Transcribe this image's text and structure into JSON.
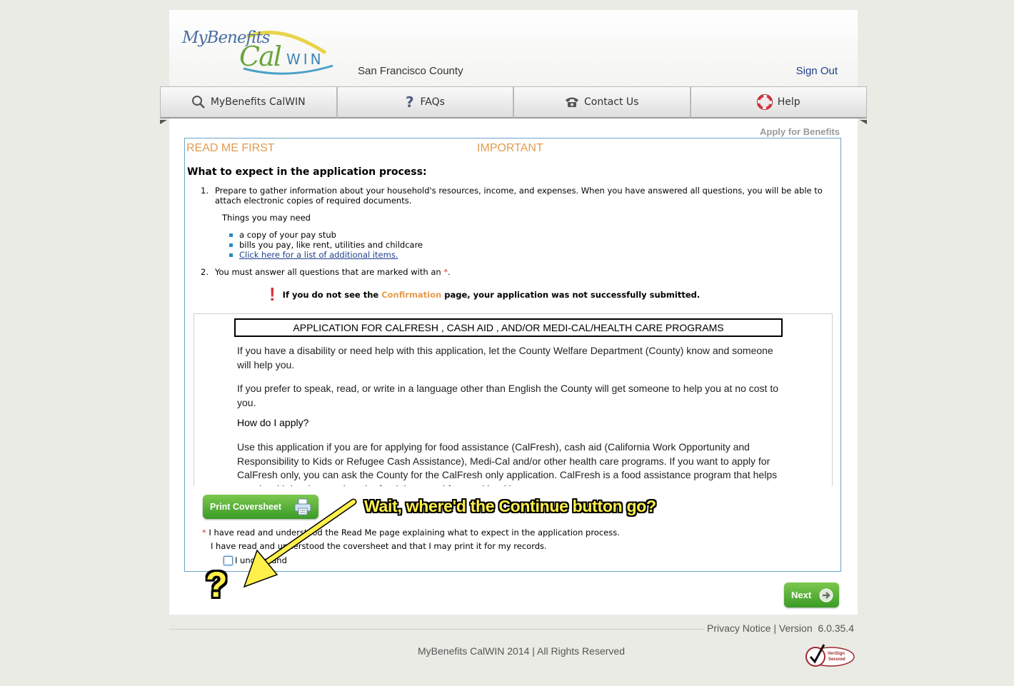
{
  "header": {
    "logo_text": "MyBenefits CalWIN",
    "county": "San Francisco County",
    "sign_out": "Sign Out"
  },
  "nav": {
    "items": [
      {
        "label": "MyBenefits CalWIN",
        "icon": "search-icon"
      },
      {
        "label": "FAQs",
        "icon": "question-icon"
      },
      {
        "label": "Contact Us",
        "icon": "telephone-icon"
      },
      {
        "label": "Help",
        "icon": "lifebuoy-icon"
      }
    ]
  },
  "breadcrumb": "Apply for Benefits",
  "panel": {
    "read_me_first": "READ ME FIRST",
    "important": "IMPORTANT",
    "what_to_expect": "What to expect in the application process:",
    "step1_num": "1.",
    "step1_text": "Prepare to gather information about your household's resources, income, and expenses. When you have answered all questions, you will be able to attach electronic copies of required documents.",
    "things_label": "Things you may need",
    "things": [
      "a copy of your pay stub",
      "bills you pay, like rent, utilities and childcare"
    ],
    "additional_link": "Click here for a list of additional items.",
    "step2_num": "2.",
    "step2_text": "You must answer all questions that are marked with an",
    "required_mark": "*",
    "period": ".",
    "warning_mark": "!",
    "warning_pre": "If you do not see the ",
    "warning_highlight": "Confirmation",
    "warning_post": " page, your application was not successfully submitted."
  },
  "application": {
    "title": "APPLICATION FOR CALFRESH , CASH AID , AND/OR MEDI-CAL/HEALTH CARE PROGRAMS",
    "para1": "If you have a disability or need help with this application, let the County Welfare Department (County) know and someone will help you.",
    "para2": "If you prefer to speak, read, or write in a language other than English the County will get someone to help you at no cost to you.",
    "how_do_i_apply": "How do I apply?",
    "para3": "Use this application if you are for applying for food assistance (CalFresh), cash aid (California Work Opportunity and Responsibility to Kids or Refugee Cash Assistance), Medi-Cal and/or other health care programs. If you want to apply for CalFresh only, you can ask the County for the CalFresh only application. CalFresh is a food assistance program that helps people with low income buy the food they need for good health."
  },
  "actions": {
    "print_coversheet": "Print Coversheet",
    "ack_required_mark": "*",
    "ack1": "I have read and understood the Read Me page explaining what to expect in the application process.",
    "ack2": "I have read and understood the coversheet and that I may print it for my records.",
    "checkbox_label": "I understand",
    "next": "Next"
  },
  "annotation": {
    "text": "Wait, where'd the Continue button go?",
    "question": "?"
  },
  "footer": {
    "privacy": "Privacy Notice",
    "separator": "|",
    "version_label": "Version",
    "version": "6.0.35.4",
    "copyright": "MyBenefits CalWIN 2014 | All Rights Reserved",
    "seal_line1": "VeriSign",
    "seal_line2": "Secured"
  },
  "colors": {
    "accent_orange": "#e39b4e",
    "link_blue": "#1f3f8f",
    "panel_border": "#6fa3c7",
    "button_green": "#3a9b27",
    "required_red": "#d9363e",
    "annotation_yellow": "#fff04a"
  }
}
